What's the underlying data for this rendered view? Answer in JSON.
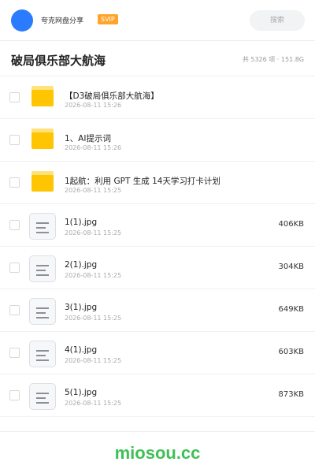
{
  "header": {
    "app_name": "夸克网盘分享",
    "badge": "SVIP",
    "search_placeholder": "搜索",
    "avatar_color": "#2b7bff"
  },
  "folder": {
    "title": "破局俱乐部大航海",
    "meta": "共 5326 项 · 151.8G"
  },
  "items": [
    {
      "type": "folder",
      "name": "【D3破局俱乐部大航海】",
      "date": "2026-08-11 15:26",
      "size": ""
    },
    {
      "type": "folder",
      "name": "1、AI提示词",
      "date": "2026-08-11 15:26",
      "size": ""
    },
    {
      "type": "folder",
      "name": "1起航：利用 GPT 生成 14天学习打卡计划",
      "date": "2026-08-11 15:25",
      "size": ""
    },
    {
      "type": "file",
      "name": "1(1).jpg",
      "date": "2026-08-11 15:25",
      "size": "406KB"
    },
    {
      "type": "file",
      "name": "2(1).jpg",
      "date": "2026-08-11 15:25",
      "size": "304KB"
    },
    {
      "type": "file",
      "name": "3(1).jpg",
      "date": "2026-08-11 15:25",
      "size": "649KB"
    },
    {
      "type": "file",
      "name": "4(1).jpg",
      "date": "2026-08-11 15:25",
      "size": "603KB"
    },
    {
      "type": "file",
      "name": "5(1).jpg",
      "date": "2026-08-11 15:25",
      "size": "873KB"
    }
  ],
  "icons": {
    "folder": "folder-icon",
    "file": "document-icon"
  },
  "colors": {
    "folder_yellow": "#ffc402",
    "badge_orange": "#ffa429",
    "watermark_green": "#3fc055"
  },
  "watermark": "miosou.cc"
}
